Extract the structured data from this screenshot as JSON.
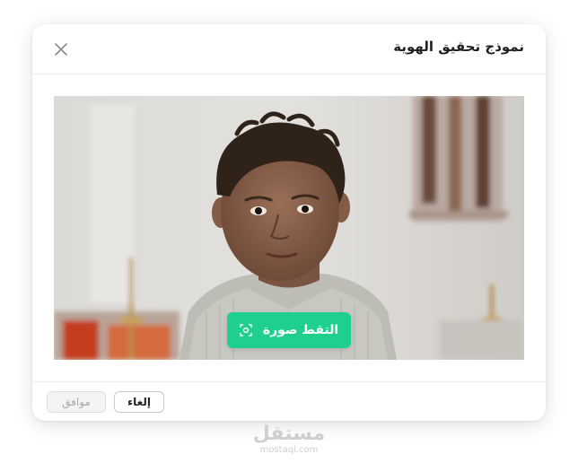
{
  "modal": {
    "title": "نموذج تحقيق الهوية",
    "close_icon": "close-icon"
  },
  "photo": {
    "capture_button_label": "التقط صورة",
    "capture_icon": "camera-focus-icon"
  },
  "footer": {
    "cancel_label": "إلغاء",
    "confirm_label": "موافق"
  },
  "watermark": {
    "logo": "مستقل",
    "domain": "mostaql.com"
  },
  "colors": {
    "accent": "#1fcf8f",
    "text": "#1f1f1f",
    "disabled_text": "#a8a8a8"
  }
}
